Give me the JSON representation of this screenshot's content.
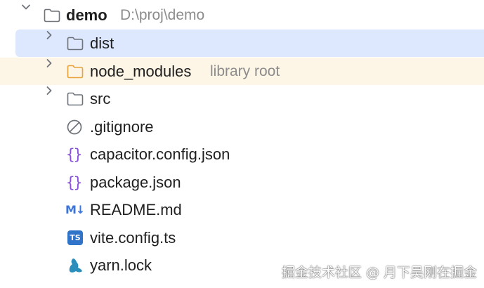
{
  "root": {
    "name": "demo",
    "path": "D:\\proj\\demo",
    "expanded": true
  },
  "items": [
    {
      "name": "dist",
      "type": "folder",
      "expandable": true,
      "selected": true,
      "icon": "folder-icon"
    },
    {
      "name": "node_modules",
      "type": "folder",
      "expandable": true,
      "hint": "library root",
      "icon": "folder-orange-icon"
    },
    {
      "name": "src",
      "type": "folder",
      "expandable": true,
      "icon": "folder-icon"
    },
    {
      "name": ".gitignore",
      "type": "file",
      "icon": "ignore-file-icon"
    },
    {
      "name": "capacitor.config.json",
      "type": "file",
      "icon": "json-icon",
      "icon_text": "{}"
    },
    {
      "name": "package.json",
      "type": "file",
      "icon": "json-icon",
      "icon_text": "{}"
    },
    {
      "name": "README.md",
      "type": "file",
      "icon": "markdown-icon",
      "icon_text": "M↓"
    },
    {
      "name": "vite.config.ts",
      "type": "file",
      "icon": "typescript-icon",
      "icon_text": "TS"
    },
    {
      "name": "yarn.lock",
      "type": "file",
      "icon": "yarn-icon"
    }
  ],
  "watermark": "掘金技术社区 @ 月下吴刚在掘金",
  "colors": {
    "selection": "#dde8ff",
    "excluded_row": "#fdf5e6",
    "folder_stroke": "#6f737a",
    "folder_orange": "#e8a33d",
    "json_purple": "#8a4fdb",
    "markdown_blue": "#3d74d8",
    "typescript_blue": "#2f74c9",
    "yarn_blue": "#2c8ebb",
    "hint_gray": "#8c8c8c"
  }
}
